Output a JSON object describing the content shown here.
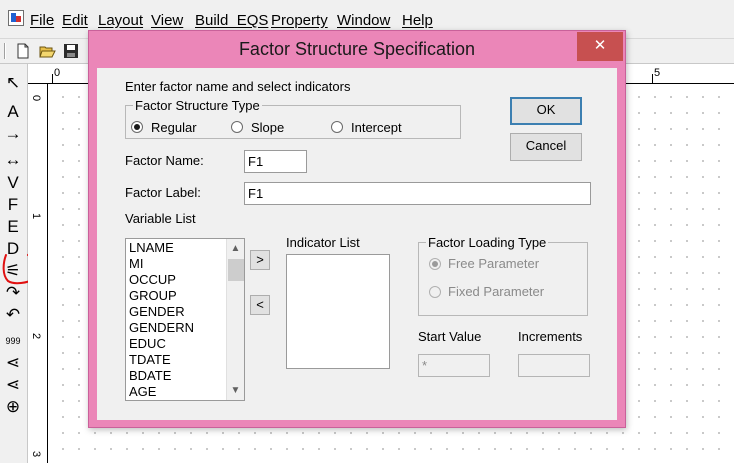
{
  "menu": {
    "items": [
      "File",
      "Edit",
      "Layout",
      "View",
      "Build_EQS",
      "Property",
      "Window",
      "Help"
    ]
  },
  "toolbar": {
    "icons": [
      "new-file-icon",
      "open-folder-icon",
      "save-icon"
    ]
  },
  "palette": {
    "tools": [
      {
        "name": "pointer-tool",
        "glyph": "↖"
      },
      {
        "name": "text-tool",
        "glyph": "A"
      },
      {
        "name": "one-way-arrow-tool",
        "glyph": "→"
      },
      {
        "name": "two-way-arrow-tool",
        "glyph": "↔"
      },
      {
        "name": "v-variable-tool",
        "glyph": "V"
      },
      {
        "name": "f-factor-tool",
        "glyph": "F"
      },
      {
        "name": "e-error-tool",
        "glyph": "E"
      },
      {
        "name": "d-disturbance-tool",
        "glyph": "D"
      },
      {
        "name": "factor-structure-tool",
        "glyph": "⚟"
      },
      {
        "name": "curved-arrow-right-tool",
        "glyph": "↷"
      },
      {
        "name": "curved-arrow-left-tool",
        "glyph": "↶"
      },
      {
        "name": "fixed-value-tool",
        "glyph": "999"
      },
      {
        "name": "tree-structure-tool",
        "glyph": "⋖"
      },
      {
        "name": "tree-structure-alt-tool",
        "glyph": "⋖"
      },
      {
        "name": "crosshair-tool",
        "glyph": "⊕"
      }
    ]
  },
  "rulers": {
    "horizontal": [
      "0",
      "5"
    ],
    "vertical": [
      "0",
      "1",
      "2",
      "3"
    ]
  },
  "dialog": {
    "title": "Factor Structure Specification",
    "close_glyph": "✕",
    "instruction": "Enter factor name and select indicators",
    "structure_type": {
      "caption": "Factor Structure Type",
      "options": [
        "Regular",
        "Slope",
        "Intercept"
      ],
      "selected": "Regular"
    },
    "ok_label": "OK",
    "cancel_label": "Cancel",
    "factor_name_label": "Factor Name:",
    "factor_name_value": "F1",
    "factor_label_label": "Factor Label:",
    "factor_label_value": "F1",
    "variable_list_label": "Variable List",
    "variables": [
      "LNAME",
      "MI",
      "OCCUP",
      "GROUP",
      "GENDER",
      "GENDERN",
      "EDUC",
      "TDATE",
      "BDATE",
      "AGE"
    ],
    "add_button": ">",
    "remove_button": "<",
    "indicator_list_label": "Indicator List",
    "loading_type": {
      "caption": "Factor Loading Type",
      "options": [
        "Free Parameter",
        "Fixed Parameter"
      ],
      "selected": "Free Parameter"
    },
    "start_value_label": "Start Value",
    "start_value": "*",
    "increments_label": "Increments",
    "increments_value": ""
  }
}
